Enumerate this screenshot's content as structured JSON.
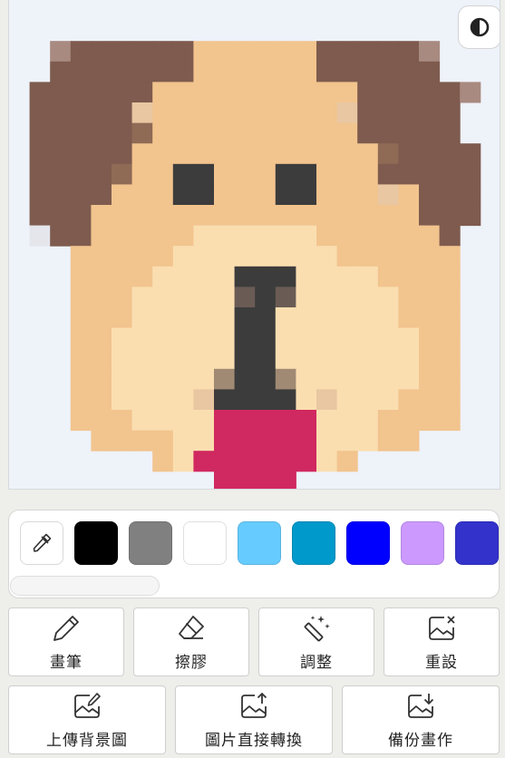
{
  "canvas": {
    "palette": {
      "a": "#7e5b4e",
      "b": "#a88a80",
      "c": "#f2c48e",
      "d": "#fadeb0",
      "e": "#3c3c3c",
      "f": "#6a5c55",
      "g": "#a08a74",
      "h": "#d02860",
      "i": "#e9c7a2",
      "j": "#e4e6ec",
      "k": "#8f6a55"
    },
    "grid": [
      "......................",
      "......................",
      "..baaaaaaccccccaaaaab..",
      "..aaaaaaaccccccaaaaaa..",
      ".aaaaaaccccccccccaaaaab",
      ".aaaaaiccccccccciaaaaa",
      ".aaaaakccccccccccaaaaa",
      ".aaaaacccccccccccckaaaa",
      ".aaaakcceeccceecccaaaaa",
      ".aaaaccceeccceecccicaaa",
      ".aaaccccccccccccccccaaa",
      ".jaacccccddddddcccccca.",
      "...cccccddddddddcccccc.",
      "...ccccddddeeeddddcccc.",
      "...cccdddddfefdddddccc.",
      "...cccdddddeeddddddccc.",
      "...ccddddddeedddddddcc.",
      "...ccddddddeedddddddcc.",
      "...ccdddddgeegddddddcc.",
      "...ccddddieeeedidddccc.",
      "...cccddddhhhhhdddcccc.",
      "....ccccddhhhhhdddcc...",
      ".......cdhhhhhhdc.......",
      "..........hhhh.........",
      "......................"
    ]
  },
  "palette_colors": [
    "#000000",
    "#808080",
    "#ffffff",
    "#66ccff",
    "#0099cc",
    "#0000ff",
    "#cc99ff",
    "#3333cc"
  ],
  "tools": {
    "pen": "畫筆",
    "eraser": "擦膠",
    "adjust": "調整",
    "reset": "重設",
    "upload_bg": "上傳背景圖",
    "convert_image": "圖片直接轉換",
    "backup": "備份畫作"
  }
}
